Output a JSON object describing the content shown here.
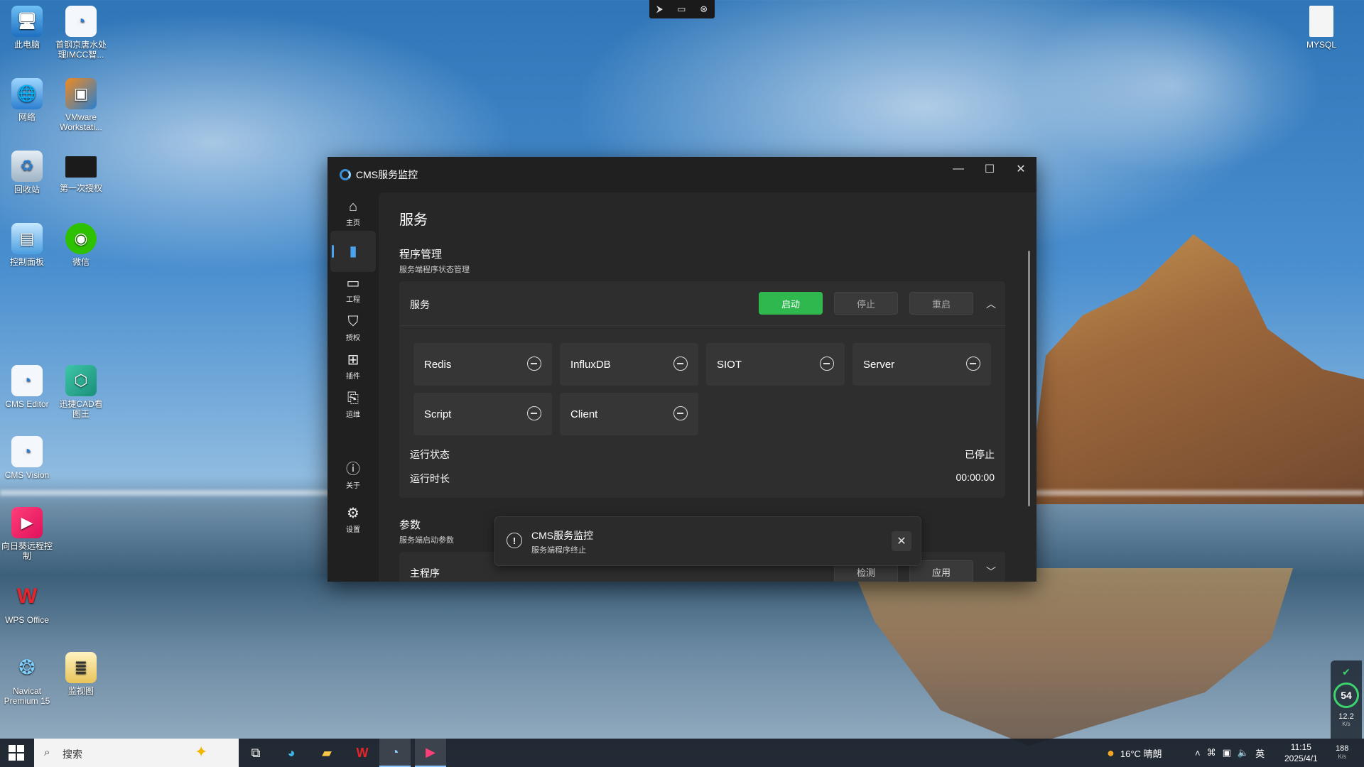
{
  "desktop": {
    "icons": [
      {
        "label": "此电脑",
        "icon": "computer-icon"
      },
      {
        "label": "首钢京唐水处理IMCC智...",
        "icon": "cms-icon"
      },
      {
        "label": "网络",
        "icon": "network-icon"
      },
      {
        "label": "VMware Workstati...",
        "icon": "vmware-icon"
      },
      {
        "label": "回收站",
        "icon": "recycle-bin-icon"
      },
      {
        "label": "第一次授权",
        "icon": "video-icon"
      },
      {
        "label": "控制面板",
        "icon": "control-panel-icon"
      },
      {
        "label": "微信",
        "icon": "wechat-icon"
      },
      {
        "label": "CMS Editor",
        "icon": "cms-editor-icon"
      },
      {
        "label": "迅捷CAD看图王",
        "icon": "cad-icon"
      },
      {
        "label": "CMS Vision",
        "icon": "cms-vision-icon"
      },
      {
        "label": "向日葵远程控制",
        "icon": "sunlogin-icon"
      },
      {
        "label": "WPS Office",
        "icon": "wps-icon"
      },
      {
        "label": "Navicat Premium 15",
        "icon": "navicat-icon"
      },
      {
        "label": "监视图",
        "icon": "document-icon"
      },
      {
        "label": "MYSQL",
        "icon": "file-icon"
      }
    ]
  },
  "window": {
    "title": "CMS服务监控",
    "nav": [
      {
        "label": "主页",
        "icon": "home-icon"
      },
      {
        "label": "",
        "icon": "service-icon"
      },
      {
        "label": "工程",
        "icon": "monitor-icon"
      },
      {
        "label": "授权",
        "icon": "shield-icon"
      },
      {
        "label": "插件",
        "icon": "plugin-icon"
      },
      {
        "label": "运维",
        "icon": "maintenance-icon"
      },
      {
        "label": "关于",
        "icon": "info-icon"
      },
      {
        "label": "设置",
        "icon": "gear-icon"
      }
    ],
    "page_title": "服务",
    "program": {
      "title": "程序管理",
      "subtitle": "服务端程序状态管理",
      "card_label": "服务",
      "start": "启动",
      "stop": "停止",
      "restart": "重启",
      "services": [
        "Redis",
        "InfluxDB",
        "SIOT",
        "Server",
        "Script",
        "Client"
      ],
      "status_label": "运行状态",
      "status_value": "已停止",
      "uptime_label": "运行时长",
      "uptime_value": "00:00:00"
    },
    "params": {
      "title": "参数",
      "subtitle": "服务端启动参数",
      "main_label": "主程序",
      "check": "检测",
      "apply": "应用"
    }
  },
  "toast": {
    "title": "CMS服务监控",
    "message": "服务端程序终止"
  },
  "taskbar": {
    "search_placeholder": "搜索",
    "weather": "16°C 晴朗",
    "ime": "英",
    "time": "11:15",
    "date": "2025/4/1"
  },
  "gadget": {
    "percent": "54",
    "up": "12.2",
    "up_unit": "K/s",
    "down": "188",
    "down_unit": "K/s"
  }
}
